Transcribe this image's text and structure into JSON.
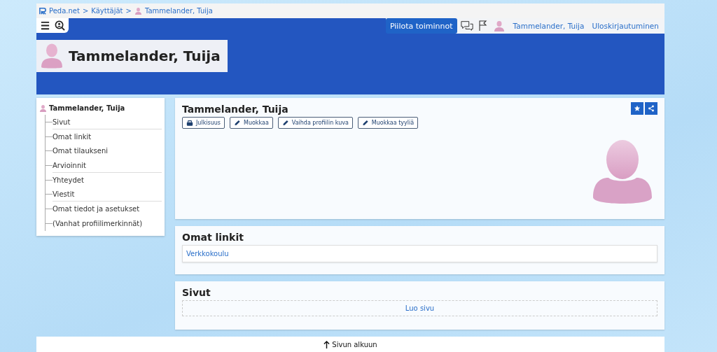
{
  "breadcrumb": {
    "separator": ">",
    "items": [
      {
        "label": "Peda.net",
        "kind": "logo"
      },
      {
        "label": "Käyttäjät",
        "kind": "plain"
      },
      {
        "label": "Tammelander, Tuija",
        "kind": "user"
      }
    ]
  },
  "header": {
    "hide_actions_button": "Piilota toiminnot",
    "user_name": "Tammelander, Tuija",
    "logout": "Uloskirjautuminen",
    "page_title": "Tammelander, Tuija"
  },
  "sidebar": {
    "root": "Tammelander, Tuija",
    "children": [
      {
        "label": "Sivut",
        "group_end": true
      },
      {
        "label": "Omat linkit",
        "group_end": false
      },
      {
        "label": "Omat tilaukseni",
        "group_end": false
      },
      {
        "label": "Arvioinnit",
        "group_end": true
      },
      {
        "label": "Yhteydet",
        "group_end": false
      },
      {
        "label": "Viestit",
        "group_end": true
      },
      {
        "label": "Omat tiedot ja asetukset",
        "group_end": false
      },
      {
        "label": "(Vanhat profiilimerkinnät)",
        "group_end": false
      }
    ]
  },
  "profile": {
    "title": "Tammelander, Tuija",
    "buttons": [
      {
        "label": "Julkisuus",
        "kind": "lock"
      },
      {
        "label": "Muokkaa",
        "kind": "edit"
      },
      {
        "label": "Vaihda profiilin kuva",
        "kind": "edit"
      },
      {
        "label": "Muokkaa tyyliä",
        "kind": "edit"
      }
    ]
  },
  "links_section": {
    "title": "Omat linkit",
    "links": [
      "Verkkokoulu"
    ]
  },
  "pages_section": {
    "title": "Sivut",
    "create": "Luo sivu"
  },
  "footer": {
    "back_to_top": "Sivun alkuun"
  }
}
